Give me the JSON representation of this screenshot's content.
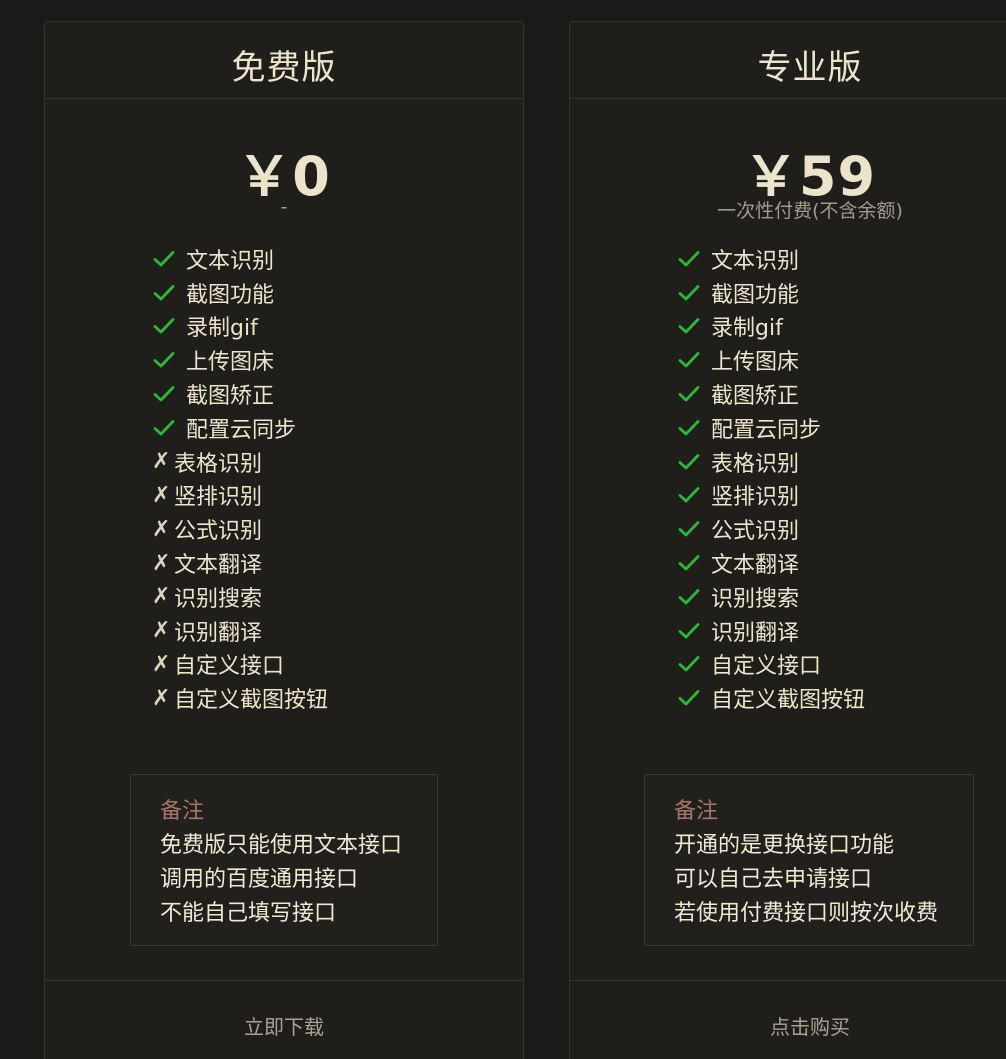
{
  "colors": {
    "background": "#1b1a18",
    "card": "#1f1e1b",
    "check_green": "#2fb838",
    "note_title": "#a7746b",
    "text": "#ede4cd"
  },
  "free": {
    "title": "免费版",
    "price": "￥0",
    "price_note": "-",
    "features": [
      {
        "icon": "check-icon",
        "label": "文本识别"
      },
      {
        "icon": "check-icon",
        "label": "截图功能"
      },
      {
        "icon": "check-icon",
        "label": "录制gif"
      },
      {
        "icon": "check-icon",
        "label": "上传图床"
      },
      {
        "icon": "check-icon",
        "label": "截图矫正"
      },
      {
        "icon": "check-icon",
        "label": "配置云同步"
      },
      {
        "icon": "cross-icon",
        "mark": "✗",
        "label": "表格识别"
      },
      {
        "icon": "cross-icon",
        "mark": "✗",
        "label": "竖排识别"
      },
      {
        "icon": "cross-icon",
        "mark": "✗",
        "label": "公式识别"
      },
      {
        "icon": "cross-icon",
        "mark": "✗",
        "label": "文本翻译"
      },
      {
        "icon": "cross-icon",
        "mark": "✗",
        "label": "识别搜索"
      },
      {
        "icon": "cross-icon",
        "mark": "✗",
        "label": "识别翻译"
      },
      {
        "icon": "cross-icon",
        "mark": "✗",
        "label": "自定义接口"
      },
      {
        "icon": "cross-icon",
        "mark": "✗",
        "label": "自定义截图按钮"
      }
    ],
    "note": {
      "title": "备注",
      "lines": [
        "免费版只能使用文本接口",
        "调用的百度通用接口",
        "不能自己填写接口"
      ]
    },
    "button": "立即下载"
  },
  "pro": {
    "title": "专业版",
    "price": "￥59",
    "price_note": "一次性付费(不含余额)",
    "features": [
      {
        "icon": "check-icon",
        "label": "文本识别"
      },
      {
        "icon": "check-icon",
        "label": "截图功能"
      },
      {
        "icon": "check-icon",
        "label": "录制gif"
      },
      {
        "icon": "check-icon",
        "label": "上传图床"
      },
      {
        "icon": "check-icon",
        "label": "截图矫正"
      },
      {
        "icon": "check-icon",
        "label": "配置云同步"
      },
      {
        "icon": "check-icon",
        "label": "表格识别"
      },
      {
        "icon": "check-icon",
        "label": "竖排识别"
      },
      {
        "icon": "check-icon",
        "label": "公式识别"
      },
      {
        "icon": "check-icon",
        "label": "文本翻译"
      },
      {
        "icon": "check-icon",
        "label": "识别搜索"
      },
      {
        "icon": "check-icon",
        "label": "识别翻译"
      },
      {
        "icon": "check-icon",
        "label": "自定义接口"
      },
      {
        "icon": "check-icon",
        "label": "自定义截图按钮"
      }
    ],
    "note": {
      "title": "备注",
      "lines": [
        "开通的是更换接口功能",
        "可以自己去申请接口",
        "若使用付费接口则按次收费"
      ]
    },
    "button": "点击购买"
  }
}
